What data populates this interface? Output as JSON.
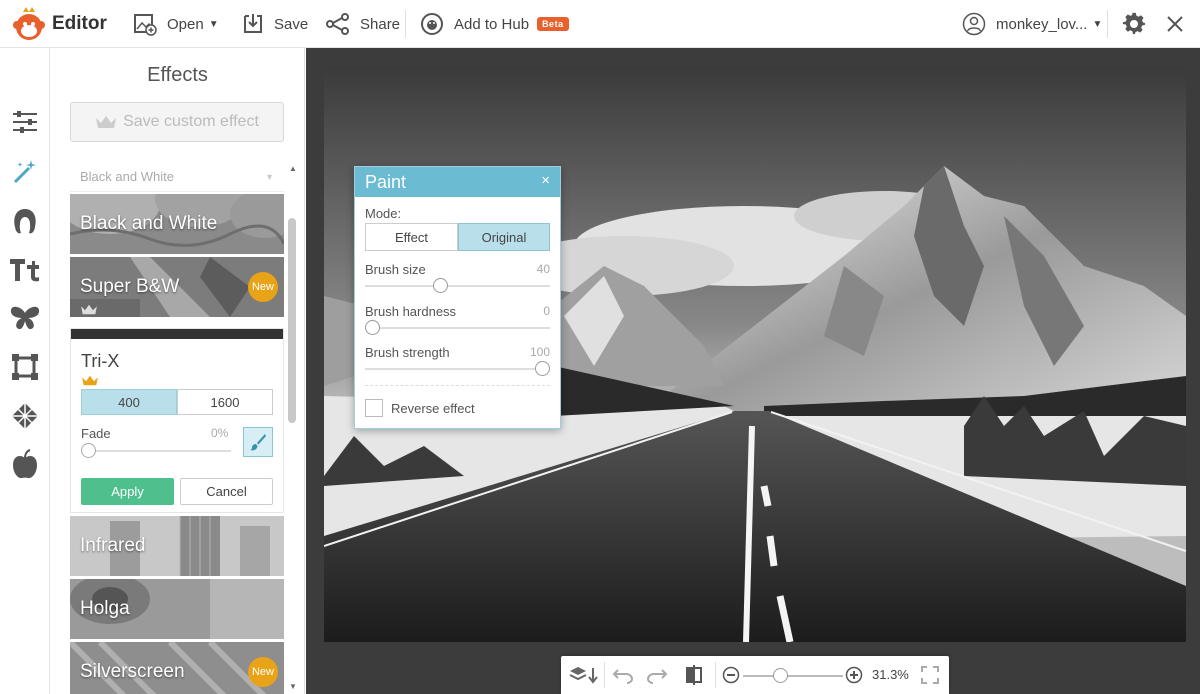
{
  "app": {
    "title": "Editor"
  },
  "toolbar": {
    "open_label": "Open",
    "save_label": "Save",
    "share_label": "Share",
    "hub_label": "Add to Hub",
    "beta_label": "Beta",
    "user_label": "monkey_lov..."
  },
  "rail": {
    "icons": [
      "adjust-icon",
      "effects-wand-icon",
      "touch-up-icon",
      "text-icon",
      "overlay-butterfly-icon",
      "frame-icon",
      "texture-icon",
      "seasonal-apple-icon"
    ]
  },
  "panel": {
    "title": "Effects",
    "save_custom_label": "Save custom effect",
    "category": "Black and White",
    "effects": [
      {
        "label": "Black and White",
        "new": ""
      },
      {
        "label": "Super B&W",
        "new": "New"
      },
      {
        "label": "Infrared",
        "new": ""
      },
      {
        "label": "Holga",
        "new": ""
      },
      {
        "label": "Silverscreen",
        "new": "New"
      }
    ],
    "active_effect": {
      "name": "Tri-X",
      "options": [
        "400",
        "1600"
      ],
      "selected_option": "400",
      "fade_label": "Fade",
      "fade_value": "0%",
      "apply_label": "Apply",
      "cancel_label": "Cancel"
    }
  },
  "paint": {
    "title": "Paint",
    "close": "×",
    "mode_label": "Mode:",
    "modes": [
      "Effect",
      "Original"
    ],
    "selected_mode": "Original",
    "brush_size_label": "Brush size",
    "brush_size_value": "40",
    "brush_hardness_label": "Brush hardness",
    "brush_hardness_value": "0",
    "brush_strength_label": "Brush strength",
    "brush_strength_value": "100",
    "reverse_label": "Reverse effect"
  },
  "bottom": {
    "zoom": "31.3%"
  },
  "colors": {
    "accent": "#6bbcd2",
    "apply": "#4fc08d",
    "beta": "#e8602c",
    "new_badge": "#e8a317"
  }
}
